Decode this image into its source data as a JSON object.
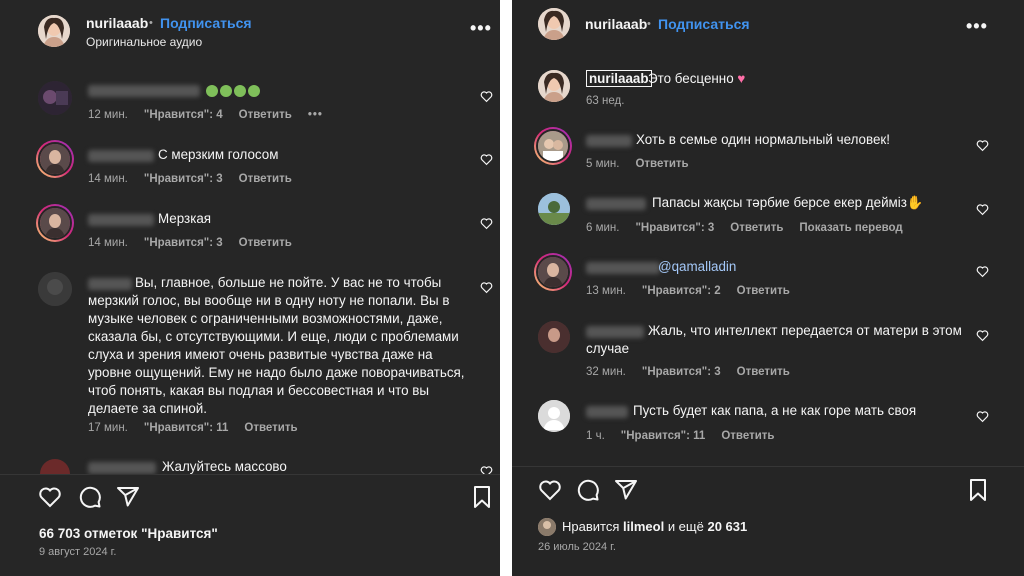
{
  "left": {
    "header": {
      "username": "nurilaaab",
      "dot": "•",
      "follow_label": "Подписаться",
      "subtitle": "Оригинальное аудио",
      "more": "•••"
    },
    "comments": [
      {
        "text": "",
        "time": "12 мин.",
        "likes": "\"Нравится\": 4",
        "reply": "Ответить",
        "more": "•••"
      },
      {
        "text": "С мерзким голосом",
        "time": "14 мин.",
        "likes": "\"Нравится\": 3",
        "reply": "Ответить"
      },
      {
        "text": "Мерзкая",
        "time": "14 мин.",
        "likes": "\"Нравится\": 3",
        "reply": "Ответить"
      },
      {
        "text": "Вы, главное, больше не пойте. У вас не то чтобы мерзкий голос, вы вообще ни в одну ноту не попали. Вы в музыке человек с ограниченными возможностями, даже, сказала бы, с отсутствующими. И еще, люди с проблемами слуха и зрения имеют очень развитые чувства даже на уровне ощущений. Ему не надо было даже поворачиваться, чтоб понять, какая вы подлая и бессовестная и что вы делаете за спиной.",
        "time": "17 мин.",
        "likes": "\"Нравится\": 11",
        "reply": "Ответить"
      },
      {
        "text": "Жалуйтесь массово"
      }
    ],
    "likes_count": "66 703 отметок \"Нравится\"",
    "date": "9 август 2024 г."
  },
  "right": {
    "header": {
      "username": "nurilaaab",
      "dot": "•",
      "follow_label": "Подписаться",
      "more": "•••"
    },
    "caption": {
      "username": "nurilaaab",
      "text": "Это бесценно",
      "time": "63 нед."
    },
    "comments": [
      {
        "text": "Хоть в семье один нормальный человек!",
        "time": "5 мин.",
        "reply": "Ответить"
      },
      {
        "text": "Папасы жақсы тәрбие берсе екер дейміз",
        "time": "6 мин.",
        "likes": "\"Нравится\": 3",
        "reply": "Ответить",
        "translate": "Показать перевод"
      },
      {
        "text": "@qamalladin",
        "time": "13 мин.",
        "likes": "\"Нравится\": 2",
        "reply": "Ответить"
      },
      {
        "text": "Жаль, что интеллект передается от матери в этом случае",
        "time": "32 мин.",
        "likes": "\"Нравится\": 3",
        "reply": "Ответить"
      },
      {
        "text": "Пусть будет как папа, а не как горе мать своя",
        "time": "1 ч.",
        "likes": "\"Нравится\": 11",
        "reply": "Ответить"
      }
    ],
    "liked_by_prefix": "Нравится",
    "liked_by_user": "lilmeol",
    "liked_by_middle": "и ещё",
    "liked_by_count": "20 631",
    "date": "26 июль 2024 г."
  },
  "icons": [
    "heart-icon",
    "comment-icon",
    "share-icon",
    "bookmark-icon",
    "more-icon"
  ],
  "colors": {
    "background": "#262626",
    "link": "#4193ef",
    "text": "#f5f5f5",
    "muted": "#a8a8a8"
  }
}
